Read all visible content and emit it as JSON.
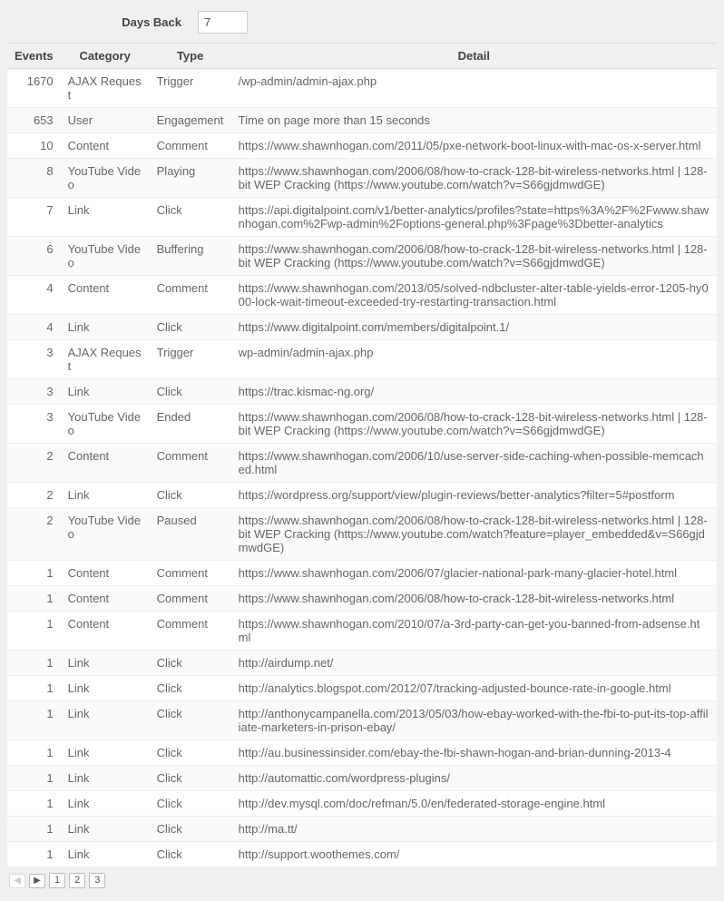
{
  "filter": {
    "label": "Days Back",
    "value": "7"
  },
  "columns": {
    "events": "Events",
    "category": "Category",
    "type": "Type",
    "detail": "Detail"
  },
  "rows": [
    {
      "events": "1670",
      "category": "AJAX Request",
      "type": "Trigger",
      "detail": "/wp-admin/admin-ajax.php"
    },
    {
      "events": "653",
      "category": "User",
      "type": "Engagement",
      "detail": "Time on page more than 15 seconds"
    },
    {
      "events": "10",
      "category": "Content",
      "type": "Comment",
      "detail": "https://www.shawnhogan.com/2011/05/pxe-network-boot-linux-with-mac-os-x-server.html"
    },
    {
      "events": "8",
      "category": "YouTube Video",
      "type": "Playing",
      "detail": "https://www.shawnhogan.com/2006/08/how-to-crack-128-bit-wireless-networks.html | 128-bit WEP Cracking (https://www.youtube.com/watch?v=S66gjdmwdGE)"
    },
    {
      "events": "7",
      "category": "Link",
      "type": "Click",
      "detail": "https://api.digitalpoint.com/v1/better-analytics/profiles?state=https%3A%2F%2Fwww.shawnhogan.com%2Fwp-admin%2Foptions-general.php%3Fpage%3Dbetter-analytics"
    },
    {
      "events": "6",
      "category": "YouTube Video",
      "type": "Buffering",
      "detail": "https://www.shawnhogan.com/2006/08/how-to-crack-128-bit-wireless-networks.html | 128-bit WEP Cracking (https://www.youtube.com/watch?v=S66gjdmwdGE)"
    },
    {
      "events": "4",
      "category": "Content",
      "type": "Comment",
      "detail": "https://www.shawnhogan.com/2013/05/solved-ndbcluster-alter-table-yields-error-1205-hy000-lock-wait-timeout-exceeded-try-restarting-transaction.html"
    },
    {
      "events": "4",
      "category": "Link",
      "type": "Click",
      "detail": "https://www.digitalpoint.com/members/digitalpoint.1/"
    },
    {
      "events": "3",
      "category": "AJAX Request",
      "type": "Trigger",
      "detail": "wp-admin/admin-ajax.php"
    },
    {
      "events": "3",
      "category": "Link",
      "type": "Click",
      "detail": "https://trac.kismac-ng.org/"
    },
    {
      "events": "3",
      "category": "YouTube Video",
      "type": "Ended",
      "detail": "https://www.shawnhogan.com/2006/08/how-to-crack-128-bit-wireless-networks.html | 128-bit WEP Cracking (https://www.youtube.com/watch?v=S66gjdmwdGE)"
    },
    {
      "events": "2",
      "category": "Content",
      "type": "Comment",
      "detail": "https://www.shawnhogan.com/2006/10/use-server-side-caching-when-possible-memcached.html"
    },
    {
      "events": "2",
      "category": "Link",
      "type": "Click",
      "detail": "https://wordpress.org/support/view/plugin-reviews/better-analytics?filter=5#postform"
    },
    {
      "events": "2",
      "category": "YouTube Video",
      "type": "Paused",
      "detail": "https://www.shawnhogan.com/2006/08/how-to-crack-128-bit-wireless-networks.html | 128-bit WEP Cracking (https://www.youtube.com/watch?feature=player_embedded&v=S66gjdmwdGE)"
    },
    {
      "events": "1",
      "category": "Content",
      "type": "Comment",
      "detail": "https://www.shawnhogan.com/2006/07/glacier-national-park-many-glacier-hotel.html"
    },
    {
      "events": "1",
      "category": "Content",
      "type": "Comment",
      "detail": "https://www.shawnhogan.com/2006/08/how-to-crack-128-bit-wireless-networks.html"
    },
    {
      "events": "1",
      "category": "Content",
      "type": "Comment",
      "detail": "https://www.shawnhogan.com/2010/07/a-3rd-party-can-get-you-banned-from-adsense.html"
    },
    {
      "events": "1",
      "category": "Link",
      "type": "Click",
      "detail": "http://airdump.net/"
    },
    {
      "events": "1",
      "category": "Link",
      "type": "Click",
      "detail": "http://analytics.blogspot.com/2012/07/tracking-adjusted-bounce-rate-in-google.html"
    },
    {
      "events": "1",
      "category": "Link",
      "type": "Click",
      "detail": "http://anthonycampanella.com/2013/05/03/how-ebay-worked-with-the-fbi-to-put-its-top-affiliate-marketers-in-prison-ebay/"
    },
    {
      "events": "1",
      "category": "Link",
      "type": "Click",
      "detail": "http://au.businessinsider.com/ebay-the-fbi-shawn-hogan-and-brian-dunning-2013-4"
    },
    {
      "events": "1",
      "category": "Link",
      "type": "Click",
      "detail": "http://automattic.com/wordpress-plugins/"
    },
    {
      "events": "1",
      "category": "Link",
      "type": "Click",
      "detail": "http://dev.mysql.com/doc/refman/5.0/en/federated-storage-engine.html"
    },
    {
      "events": "1",
      "category": "Link",
      "type": "Click",
      "detail": "http://ma.tt/"
    },
    {
      "events": "1",
      "category": "Link",
      "type": "Click",
      "detail": "http://support.woothemes.com/"
    }
  ],
  "pager": {
    "prev": "◀",
    "next": "▶",
    "pages": [
      "1",
      "2",
      "3"
    ]
  }
}
